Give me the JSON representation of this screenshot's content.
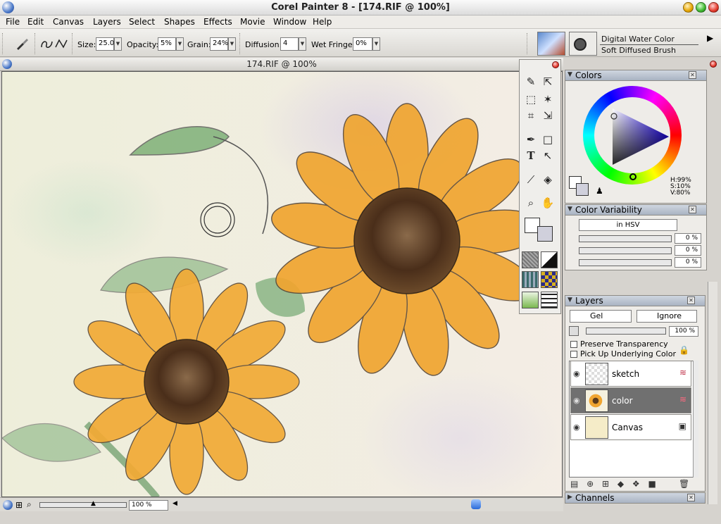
{
  "window": {
    "title": "Corel Painter 8 - [174.RIF @ 100%]"
  },
  "menu": [
    "File",
    "Edit",
    "Canvas",
    "Layers",
    "Select",
    "Shapes",
    "Effects",
    "Movie",
    "Window",
    "Help"
  ],
  "property_bar": {
    "size_label": "Size:",
    "size_value": "25.0",
    "opacity_label": "Opacity:",
    "opacity_value": "5%",
    "grain_label": "Grain:",
    "grain_value": "24%",
    "diffusion_label": "Diffusion:",
    "diffusion_value": "4",
    "wet_fringe_label": "Wet Fringe:",
    "wet_fringe_value": "0%",
    "brush_category": "Digital Water Color",
    "brush_variant": "Soft Diffused Brush"
  },
  "document": {
    "title": "174.RIF @ 100%",
    "zoom": "100 %"
  },
  "colors_panel": {
    "title": "Colors",
    "h": "H:99%",
    "s": "S:10%",
    "v": "V:80%"
  },
  "color_variability_panel": {
    "title": "Color Variability",
    "mode": "in HSV",
    "values": [
      "0 %",
      "0 %",
      "0 %"
    ]
  },
  "layers_panel": {
    "title": "Layers",
    "composite_method": "Gel",
    "depth": "Ignore",
    "opacity": "100 %",
    "preserve_transparency": "Preserve Transparency",
    "pick_up_underlying": "Pick Up Underlying Color",
    "layers": [
      {
        "name": "sketch",
        "selected": false
      },
      {
        "name": "color",
        "selected": true
      },
      {
        "name": "Canvas",
        "selected": false
      }
    ]
  },
  "channels_panel": {
    "title": "Channels"
  },
  "icons": {
    "app": "painter-logo-icon",
    "brush": "brush-icon",
    "stroke": "freehand-stroke-icon",
    "dropper": "dropper-icon",
    "magnifier": "magnifier-icon",
    "grabber": "grabber-hand-icon",
    "text": "text-tool-icon",
    "crop": "crop-icon",
    "eye": "eye-icon",
    "lock": "lock-icon"
  },
  "accent_colors": {
    "title_gradient_top": "#fafafa",
    "palette_header": "#b8c0cc",
    "selected_layer": "#707070",
    "close_button": "#e43a2c"
  }
}
